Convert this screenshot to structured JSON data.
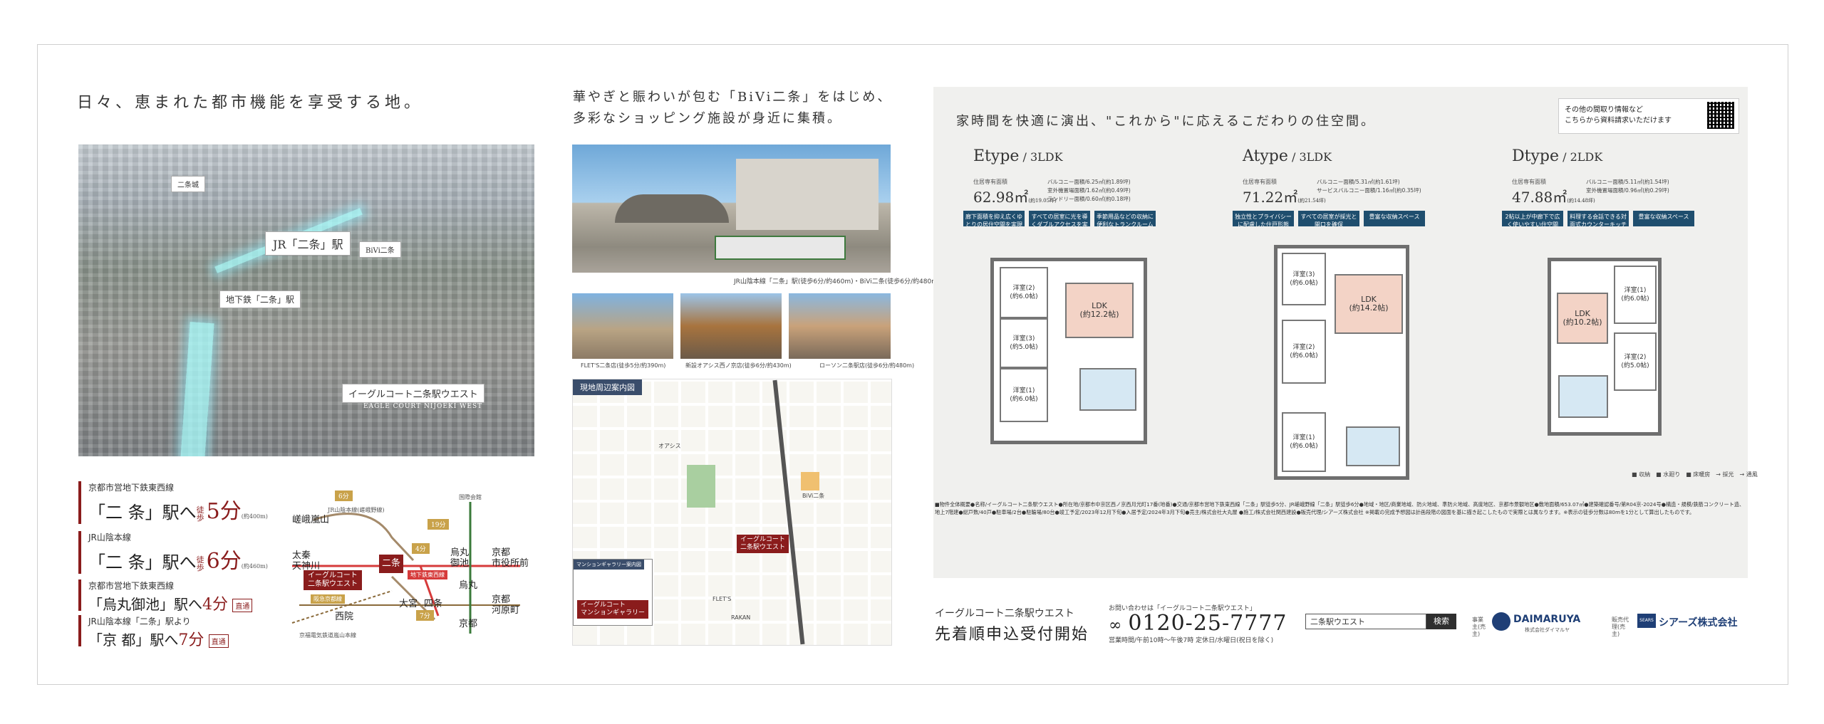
{
  "panel1": {
    "heading": "日々、恵まれた都市機能を享受する地。",
    "aerial_labels": {
      "nijojo": "二条城",
      "jr_nijo": "JR「二条」駅",
      "bivi": "BiVi二条",
      "subway_nijo": "地下鉄「二条」駅",
      "property": "イーグルコート二条駅ウエスト",
      "property_en": "EAGLE COURT NIJOEKI WEST"
    },
    "access": [
      {
        "line": "京都市営地下鉄東西線",
        "station": "「二 条」駅へ",
        "walk": "徒歩",
        "minutes": "5分",
        "note": "(約400m)",
        "direct": ""
      },
      {
        "line": "JR山陰本線",
        "station": "「二 条」駅へ",
        "walk": "徒歩",
        "minutes": "6分",
        "note": "(約460m)",
        "direct": ""
      },
      {
        "line": "京都市営地下鉄東西線",
        "station": "「烏丸御池」駅へ",
        "walk": "",
        "minutes": "4分",
        "note": "",
        "direct": "直通"
      },
      {
        "line": "JR山陰本線「二条」駅より",
        "station": "「京 都」駅へ",
        "walk": "",
        "minutes": "7分",
        "note": "",
        "direct": "直通"
      }
    ],
    "route_map": {
      "saga": "嵯峨嵐山",
      "saga_sub": "JR山陰本線(嵯峨野線)",
      "uzumasa": "太秦\n天神川",
      "nijo": "二条",
      "property_tag": "イーグルコート\n二条駅ウエスト",
      "tozai": "地下鉄東西線",
      "karasuma_oike": "烏丸\n御池",
      "shiyakusho": "京都\n市役所前",
      "karasuma": "烏丸",
      "shijo": "四条",
      "kawaramachi": "京都\n河原町",
      "omiya": "大宮",
      "kyoto": "京都",
      "saiin": "西院",
      "kokusaikaikan": "国際会館",
      "min6": "6分",
      "min4": "4分",
      "min19": "19分",
      "min7": "7分",
      "hankyu": "阪急京都線",
      "randen": "京福電気鉄道嵐山本線"
    }
  },
  "panel2": {
    "heading_line1": "華やぎと賑わいが包む「BiVi二条」をはじめ、",
    "heading_line2": "多彩なショッピング施設が身近に集積。",
    "main_caption": "JR山陰本線「二条」駅(徒歩6分/約460m)・BiVi二条(徒歩6分/約480m)",
    "photos": [
      {
        "caption": "FLET'S二条店(徒歩5分/約390m)"
      },
      {
        "caption": "新設オアシス西ノ京店(徒歩6分/約430m)"
      },
      {
        "caption": "ローソン二条駅店(徒歩6分/約480m)"
      }
    ],
    "map_title": "現地周辺案内図",
    "map_labels": {
      "property": "イーグルコート\n二条駅ウエスト",
      "gallery": "イーグルコート\nマンションギャラリー",
      "gallery_box": "マンションギャラリー案内図",
      "bivi": "BiVi二条",
      "flets": "FLET'S",
      "rakan": "RAKAN",
      "oasis": "オアシス"
    }
  },
  "panel3": {
    "heading": "家時間を快適に演出、\"これから\"に応えるこだわりの住空間。",
    "qr_text_line1": "その他の間取り情報など",
    "qr_text_line2": "こちらから資料請求いただけます",
    "plans": [
      {
        "type": "Etype",
        "layout": "3LDK",
        "area_label": "住居専有面積",
        "area": "62.98㎡",
        "area_tsubo": "(約19.05坪)",
        "details": [
          "バルコニー面積/6.25㎡(約1.89坪)",
          "室外機置場面積/1.62㎡(約0.49坪)",
          "ランドリー面積/0.60㎡(約0.18坪)"
        ],
        "features": [
          "廊下面積を抑え広くゆとりの居住空間を実現",
          "すべての居室に光を導くダブルアクセスを実現",
          "季節用品などの収納に便利なトランクルーム"
        ],
        "rooms": {
          "w2": "洋室(2)\n(約6.0帖)",
          "w3": "洋室(3)\n(約5.0帖)",
          "w1": "洋室(1)\n(約6.0帖)",
          "ldk": "LDK\n(約12.2帖)"
        }
      },
      {
        "type": "Atype",
        "layout": "3LDK",
        "area_label": "住居専有面積",
        "area": "71.22㎡",
        "area_tsubo": "(約21.54坪)",
        "details": [
          "バルコニー面積/5.31㎡(約1.61坪)",
          "サービスバルコニー面積/1.16㎡(約0.35坪)"
        ],
        "features": [
          "独立性とプライバシーに配慮した住戸形態",
          "すべての居室が採光と開口を確保",
          "豊富な収納スペース"
        ],
        "rooms": {
          "w3": "洋室(3)\n(約6.0帖)",
          "w2": "洋室(2)\n(約6.0帖)",
          "w1": "洋室(1)\n(約6.0帖)",
          "ldk": "LDK\n(約14.2帖)"
        }
      },
      {
        "type": "Dtype",
        "layout": "2LDK",
        "area_label": "住居専有面積",
        "area": "47.88㎡",
        "area_tsubo": "(約14.48坪)",
        "details": [
          "バルコニー面積/5.11㎡(約1.54坪)",
          "室外機置場面積/0.96㎡(約0.29坪)"
        ],
        "features": [
          "2帖以上が中廊下で広く使いやすい住空間",
          "料理する会話できる対面式カウンターキッチン",
          "豊富な収納スペース"
        ],
        "rooms": {
          "w1": "洋室(1)\n(約6.0帖)",
          "w2": "洋室(2)\n(約5.0帖)",
          "ldk": "LDK\n(約10.2帖)"
        }
      }
    ],
    "legend": "■ 収納　■ 水廻り　■ 床暖房　→ 採光　→ 通風",
    "fine_print": "■物件全体概要●名称/イーグルコート二条駅ウエスト●所在地/京都市中京区西ノ京西月光町17番(地番)●交通/京都市営地下鉄東西線「二条」駅徒歩5分、JR嵯峨野線「二条」駅徒歩6分●地域・地区/商業地域、防火地域、準防火地域、高度地区、京都市景観地区●敷地面積/653.07㎡●建築確認番号/第R04京-2024号●構造・規模/鉄筋コンクリート造、地上7階建●総戸数/40戸●駐車場/2台●駐輪場/80台●竣工予定/2023年12月下旬●入居予定/2024年3月下旬●売主/株式会社大丸屋 ●施工/株式会社関西建設●販売代理/シアーズ株式会社 ※掲載の完成予想図は計画段階の図面を基に描き起こしたもので実際とは異なります。※表示の徒歩分数は80mを1分として算出したものです。",
    "bottom_name": "イーグルコート二条駅ウエスト",
    "bottom_big": "先着順申込受付開始",
    "tel_label": "お問い合わせは「イーグルコート二条駅ウエスト」",
    "tel": "0120-25-7777",
    "tel_hours": "営業時間/午前10時〜午後7時 定休日/水曜日(祝日を除く)",
    "search_value": "二条駅ウエスト",
    "search_button": "検索",
    "seller_label": "事業主(売主)",
    "seller": "DAIMARUYA",
    "seller_sub": "株式会社ダイマルヤ",
    "agent_label": "販売代理(売主)",
    "agent": "シアーズ株式会社",
    "agent_logo": "SEARS"
  },
  "colors": {
    "accent_red": "#8a1c1c",
    "navy": "#1f4e6e",
    "ldk_pink": "#f3d3c6",
    "wet_blue": "#d6e8f3"
  }
}
